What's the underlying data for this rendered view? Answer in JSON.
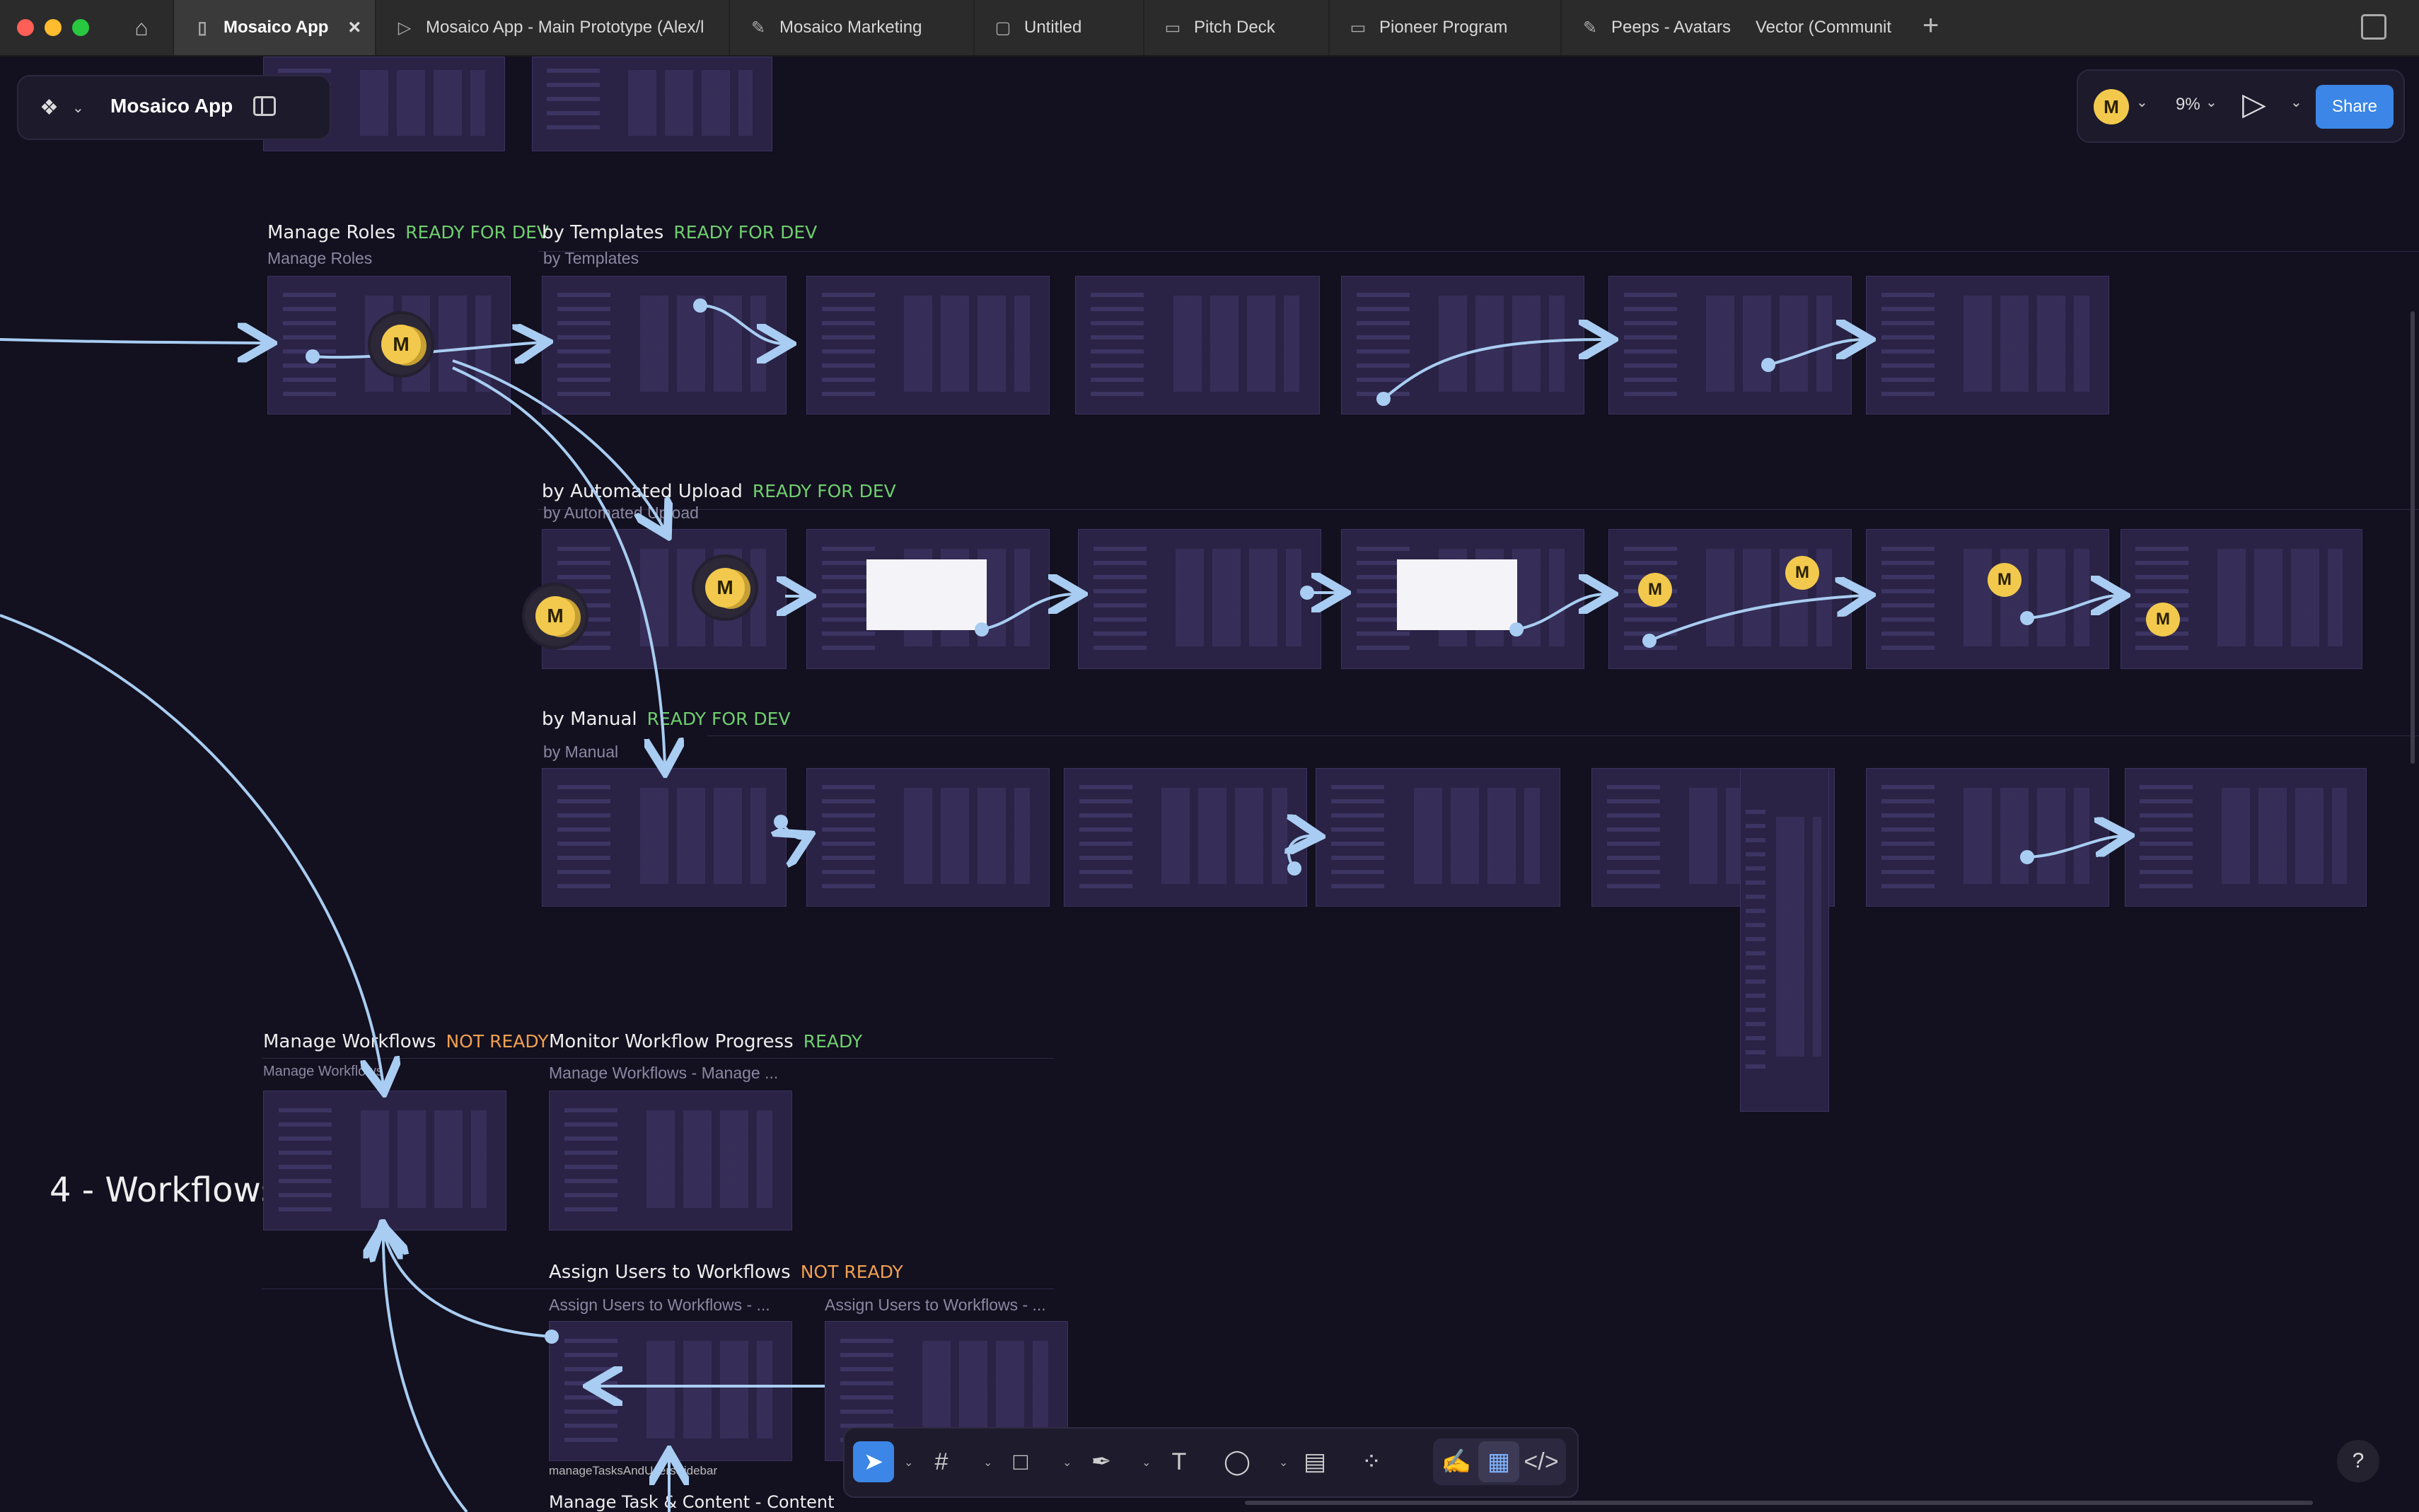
{
  "tabs": [
    {
      "label": "Mosaico App",
      "icon": "book-icon",
      "active": true
    },
    {
      "label": "Mosaico App - Main Prototype (Alex/l",
      "icon": "play-icon"
    },
    {
      "label": "Mosaico Marketing",
      "icon": "pen-tool-icon"
    },
    {
      "label": "Untitled",
      "icon": "doc-icon"
    },
    {
      "label": "Pitch Deck",
      "icon": "slides-icon"
    },
    {
      "label": "Pioneer Program",
      "icon": "slides-icon"
    },
    {
      "label": "Peeps - Avatars",
      "icon": "pen-tool-icon"
    },
    {
      "label": "Vector (Communit",
      "icon": "none"
    }
  ],
  "file": {
    "name": "Mosaico App"
  },
  "toolbar_right": {
    "avatar_initial": "M",
    "zoom": "9%",
    "share_label": "Share"
  },
  "sections": {
    "manage_roles": {
      "title": "Manage Roles",
      "status": "READY FOR DEV",
      "subtitle": "Manage Roles"
    },
    "by_templates": {
      "title": "by Templates",
      "status": "READY FOR DEV",
      "subtitle": "by Templates"
    },
    "by_automated_upload": {
      "title": "by Automated Upload",
      "status": "READY FOR DEV",
      "subtitle": "by Automated Upload"
    },
    "by_manual": {
      "title": "by Manual",
      "status": "READY FOR DEV",
      "subtitle": "by Manual"
    },
    "manage_workflows": {
      "title": "Manage Workflows",
      "status": "NOT READY",
      "subtitle": "Manage Workflows"
    },
    "monitor_progress": {
      "title": "Monitor Workflow Progress",
      "status": "READY",
      "subtitle": "Manage Workflows - Manage ..."
    },
    "assign_users": {
      "title": "Assign Users to Workflows",
      "status": "NOT READY",
      "subtitle_1": "Assign Users to Workflows - ...",
      "subtitle_2": "Assign Users to Workflows - ..."
    },
    "workflows_heading": "4 - Workflows",
    "frame_label": "manageTasksAndUsersSidebar",
    "task_content": "Manage Task & Content - Content"
  },
  "cursor_initial": "M",
  "colors": {
    "ready": "#6fcf6f",
    "not_ready": "#f0a050",
    "accent": "#3b86e6",
    "canvas": "#13101f",
    "connector": "#a9cdf2"
  },
  "tools": [
    "move-tool",
    "frame-tool",
    "rectangle-tool",
    "pen-tool",
    "text-tool",
    "comment-tool",
    "actions-tool",
    "components-tool",
    "draw-mode",
    "design-mode",
    "dev-mode"
  ],
  "help_label": "?"
}
